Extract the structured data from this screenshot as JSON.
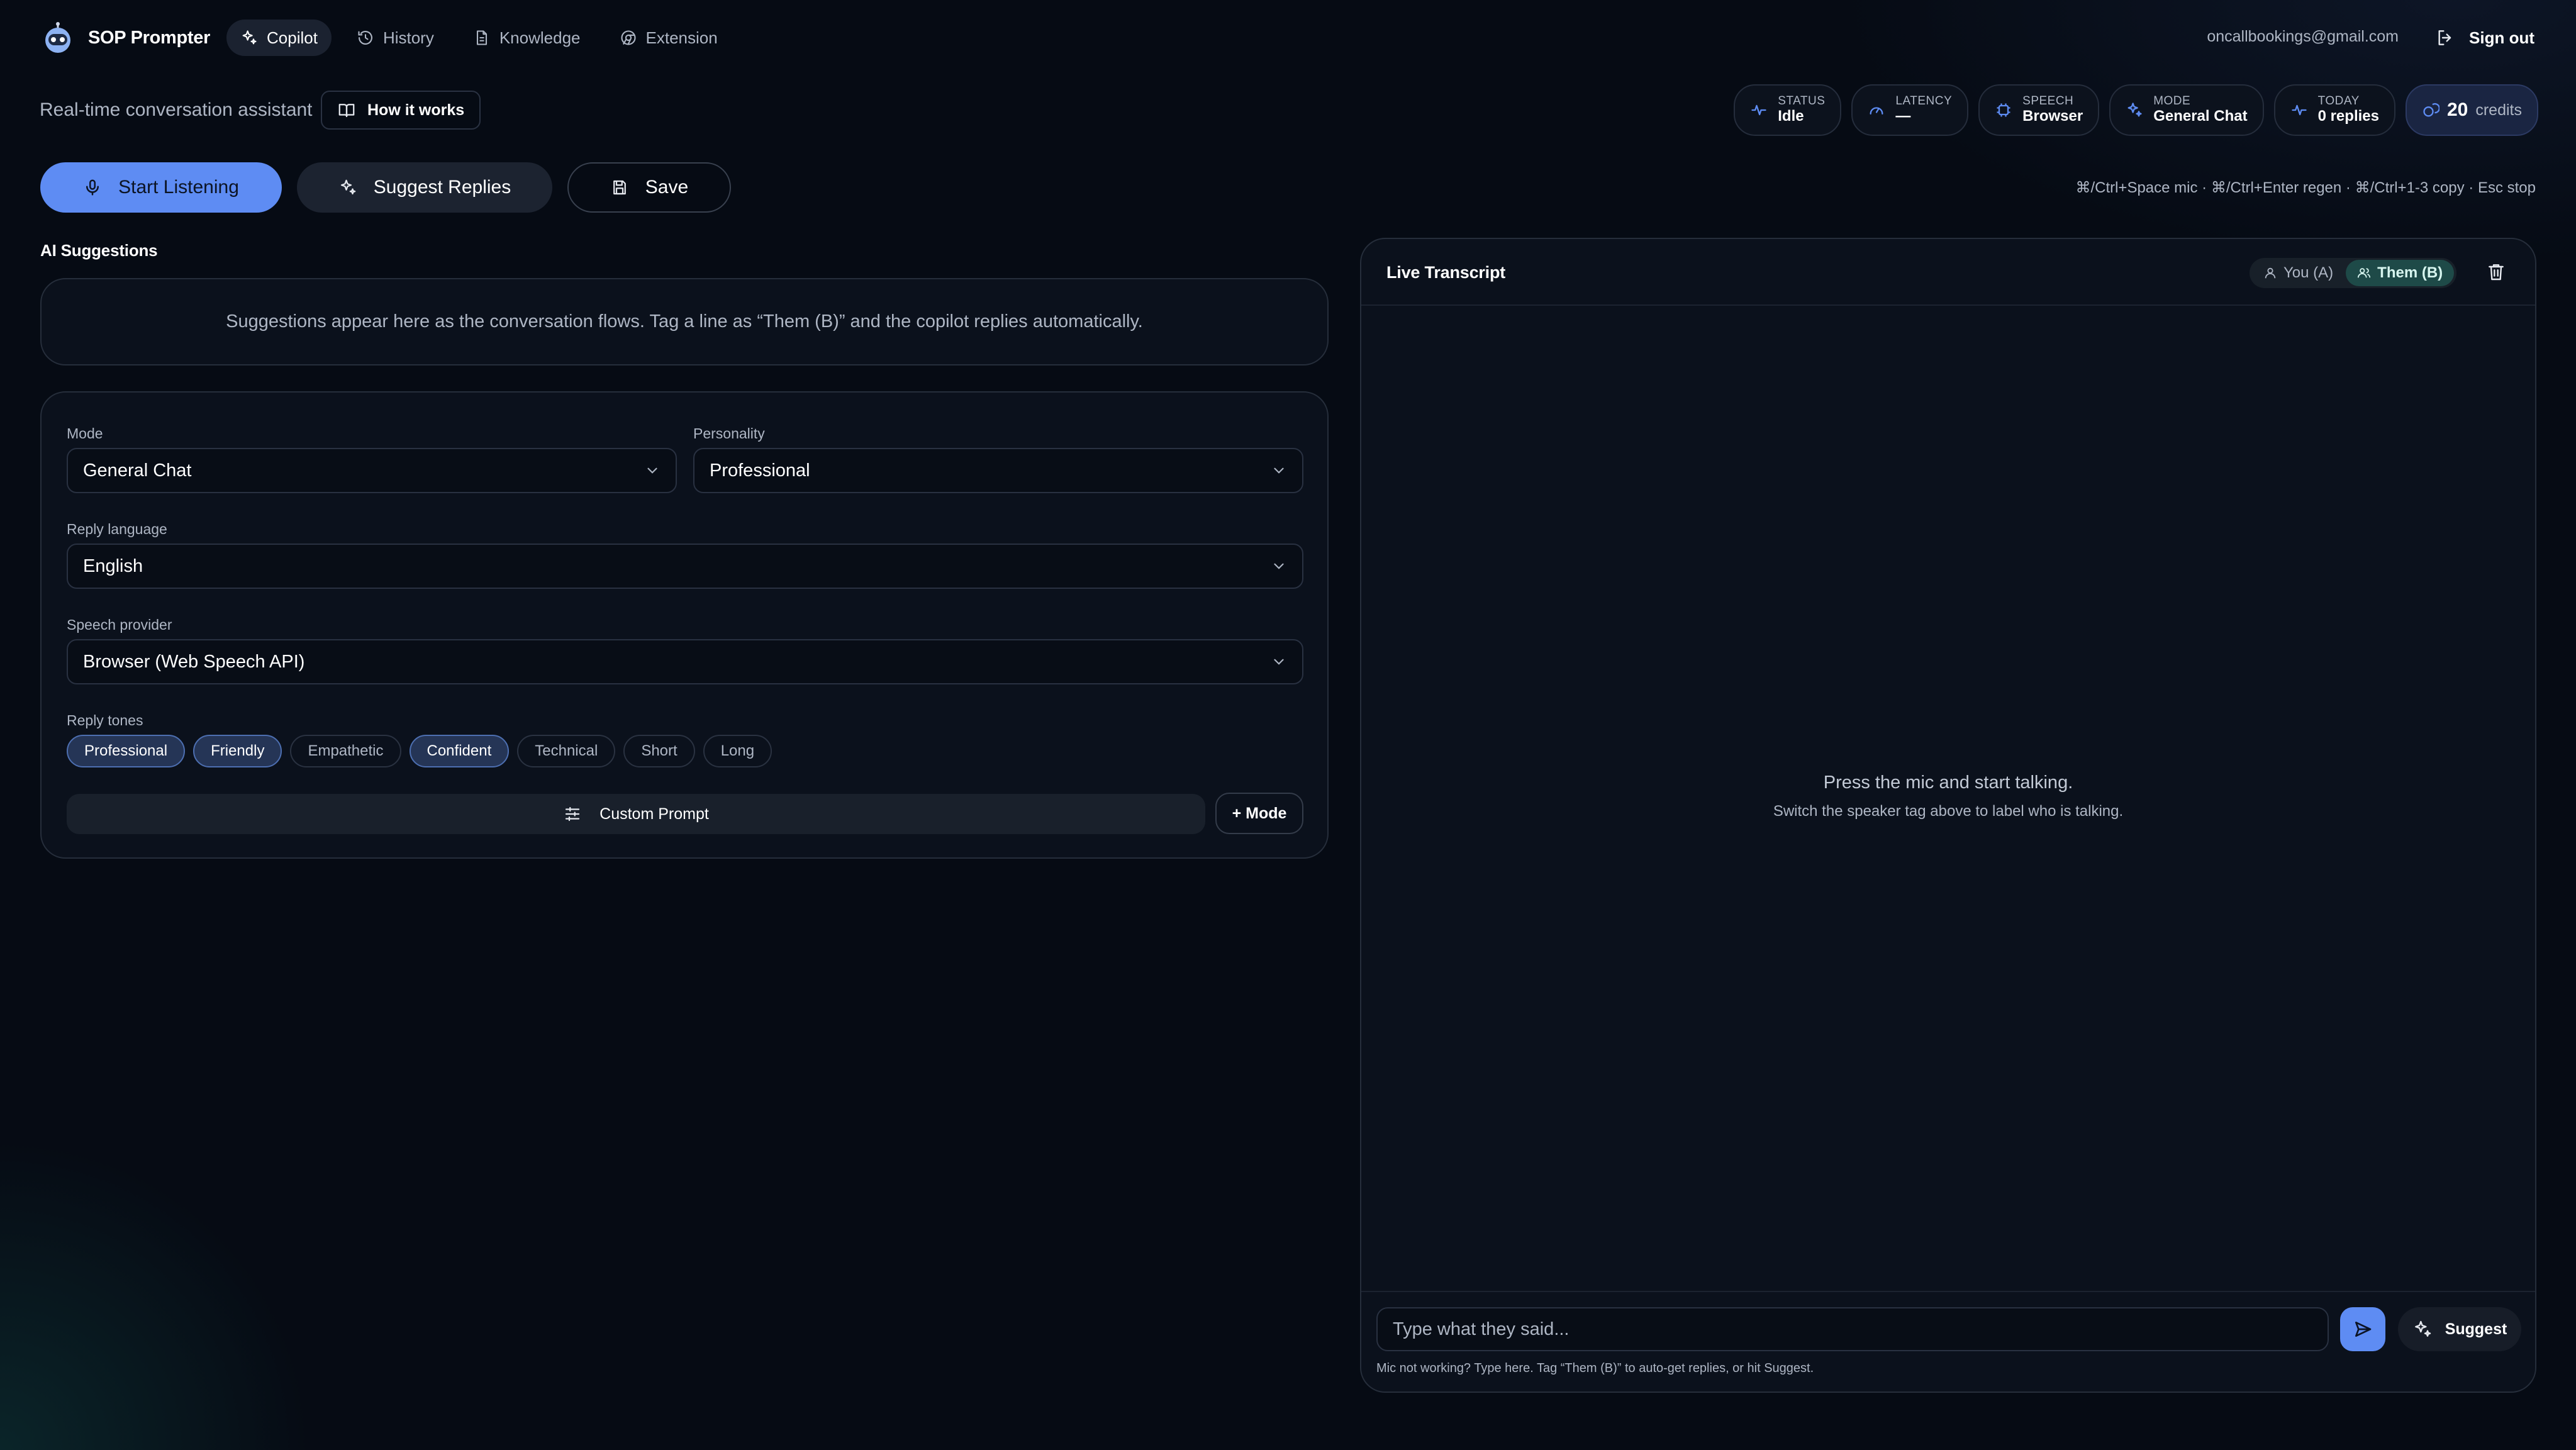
{
  "brand": {
    "name": "SOP Prompter"
  },
  "nav": [
    {
      "label": "Copilot",
      "icon": "sparkles-icon",
      "active": true
    },
    {
      "label": "History",
      "icon": "history-icon",
      "active": false
    },
    {
      "label": "Knowledge",
      "icon": "document-icon",
      "active": false
    },
    {
      "label": "Extension",
      "icon": "chrome-icon",
      "active": false
    }
  ],
  "user": {
    "email": "oncallbookings@gmail.com",
    "signout_label": "Sign out"
  },
  "header": {
    "subtitle": "Real-time conversation assistant",
    "how_it_works_label": "How it works"
  },
  "stats": {
    "status": {
      "label": "Status",
      "value": "Idle"
    },
    "latency": {
      "label": "Latency",
      "value": "—"
    },
    "speech": {
      "label": "Speech",
      "value": "Browser"
    },
    "mode": {
      "label": "Mode",
      "value": "General Chat"
    },
    "today": {
      "label": "Today",
      "value": "0 replies"
    },
    "credits": {
      "value": "20",
      "label": "credits"
    }
  },
  "actions": {
    "start_listening": "Start Listening",
    "suggest_replies": "Suggest Replies",
    "save": "Save"
  },
  "shortcuts": "⌘/Ctrl+Space mic · ⌘/Ctrl+Enter regen · ⌘/Ctrl+1-3 copy · Esc stop",
  "suggestions": {
    "title": "AI Suggestions",
    "empty_text": "Suggestions appear here as the conversation flows. Tag a line as “Them (B)” and the copilot replies automatically."
  },
  "settings": {
    "mode": {
      "label": "Mode",
      "value": "General Chat"
    },
    "personality": {
      "label": "Personality",
      "value": "Professional"
    },
    "reply_language": {
      "label": "Reply language",
      "value": "English"
    },
    "speech_provider": {
      "label": "Speech provider",
      "value": "Browser (Web Speech API)"
    },
    "tones_label": "Reply tones",
    "tones": [
      {
        "label": "Professional",
        "selected": true
      },
      {
        "label": "Friendly",
        "selected": true
      },
      {
        "label": "Empathetic",
        "selected": false
      },
      {
        "label": "Confident",
        "selected": true
      },
      {
        "label": "Technical",
        "selected": false
      },
      {
        "label": "Short",
        "selected": false
      },
      {
        "label": "Long",
        "selected": false
      }
    ],
    "custom_prompt_label": "Custom Prompt",
    "add_mode_label": "+ Mode"
  },
  "transcript": {
    "title": "Live Transcript",
    "speaker_you": "You (A)",
    "speaker_them": "Them (B)",
    "empty_main": "Press the mic and start talking.",
    "empty_sub": "Switch the speaker tag above to label who is talking.",
    "input_placeholder": "Type what they said...",
    "suggest_label": "Suggest",
    "hint": "Mic not working? Type here. Tag “Them (B)” to auto-get replies, or hit Suggest."
  },
  "colors": {
    "accent": "#5e8cf3",
    "background": "#060b14",
    "card": "#0b111c",
    "teal_active": "#1e4a48"
  }
}
